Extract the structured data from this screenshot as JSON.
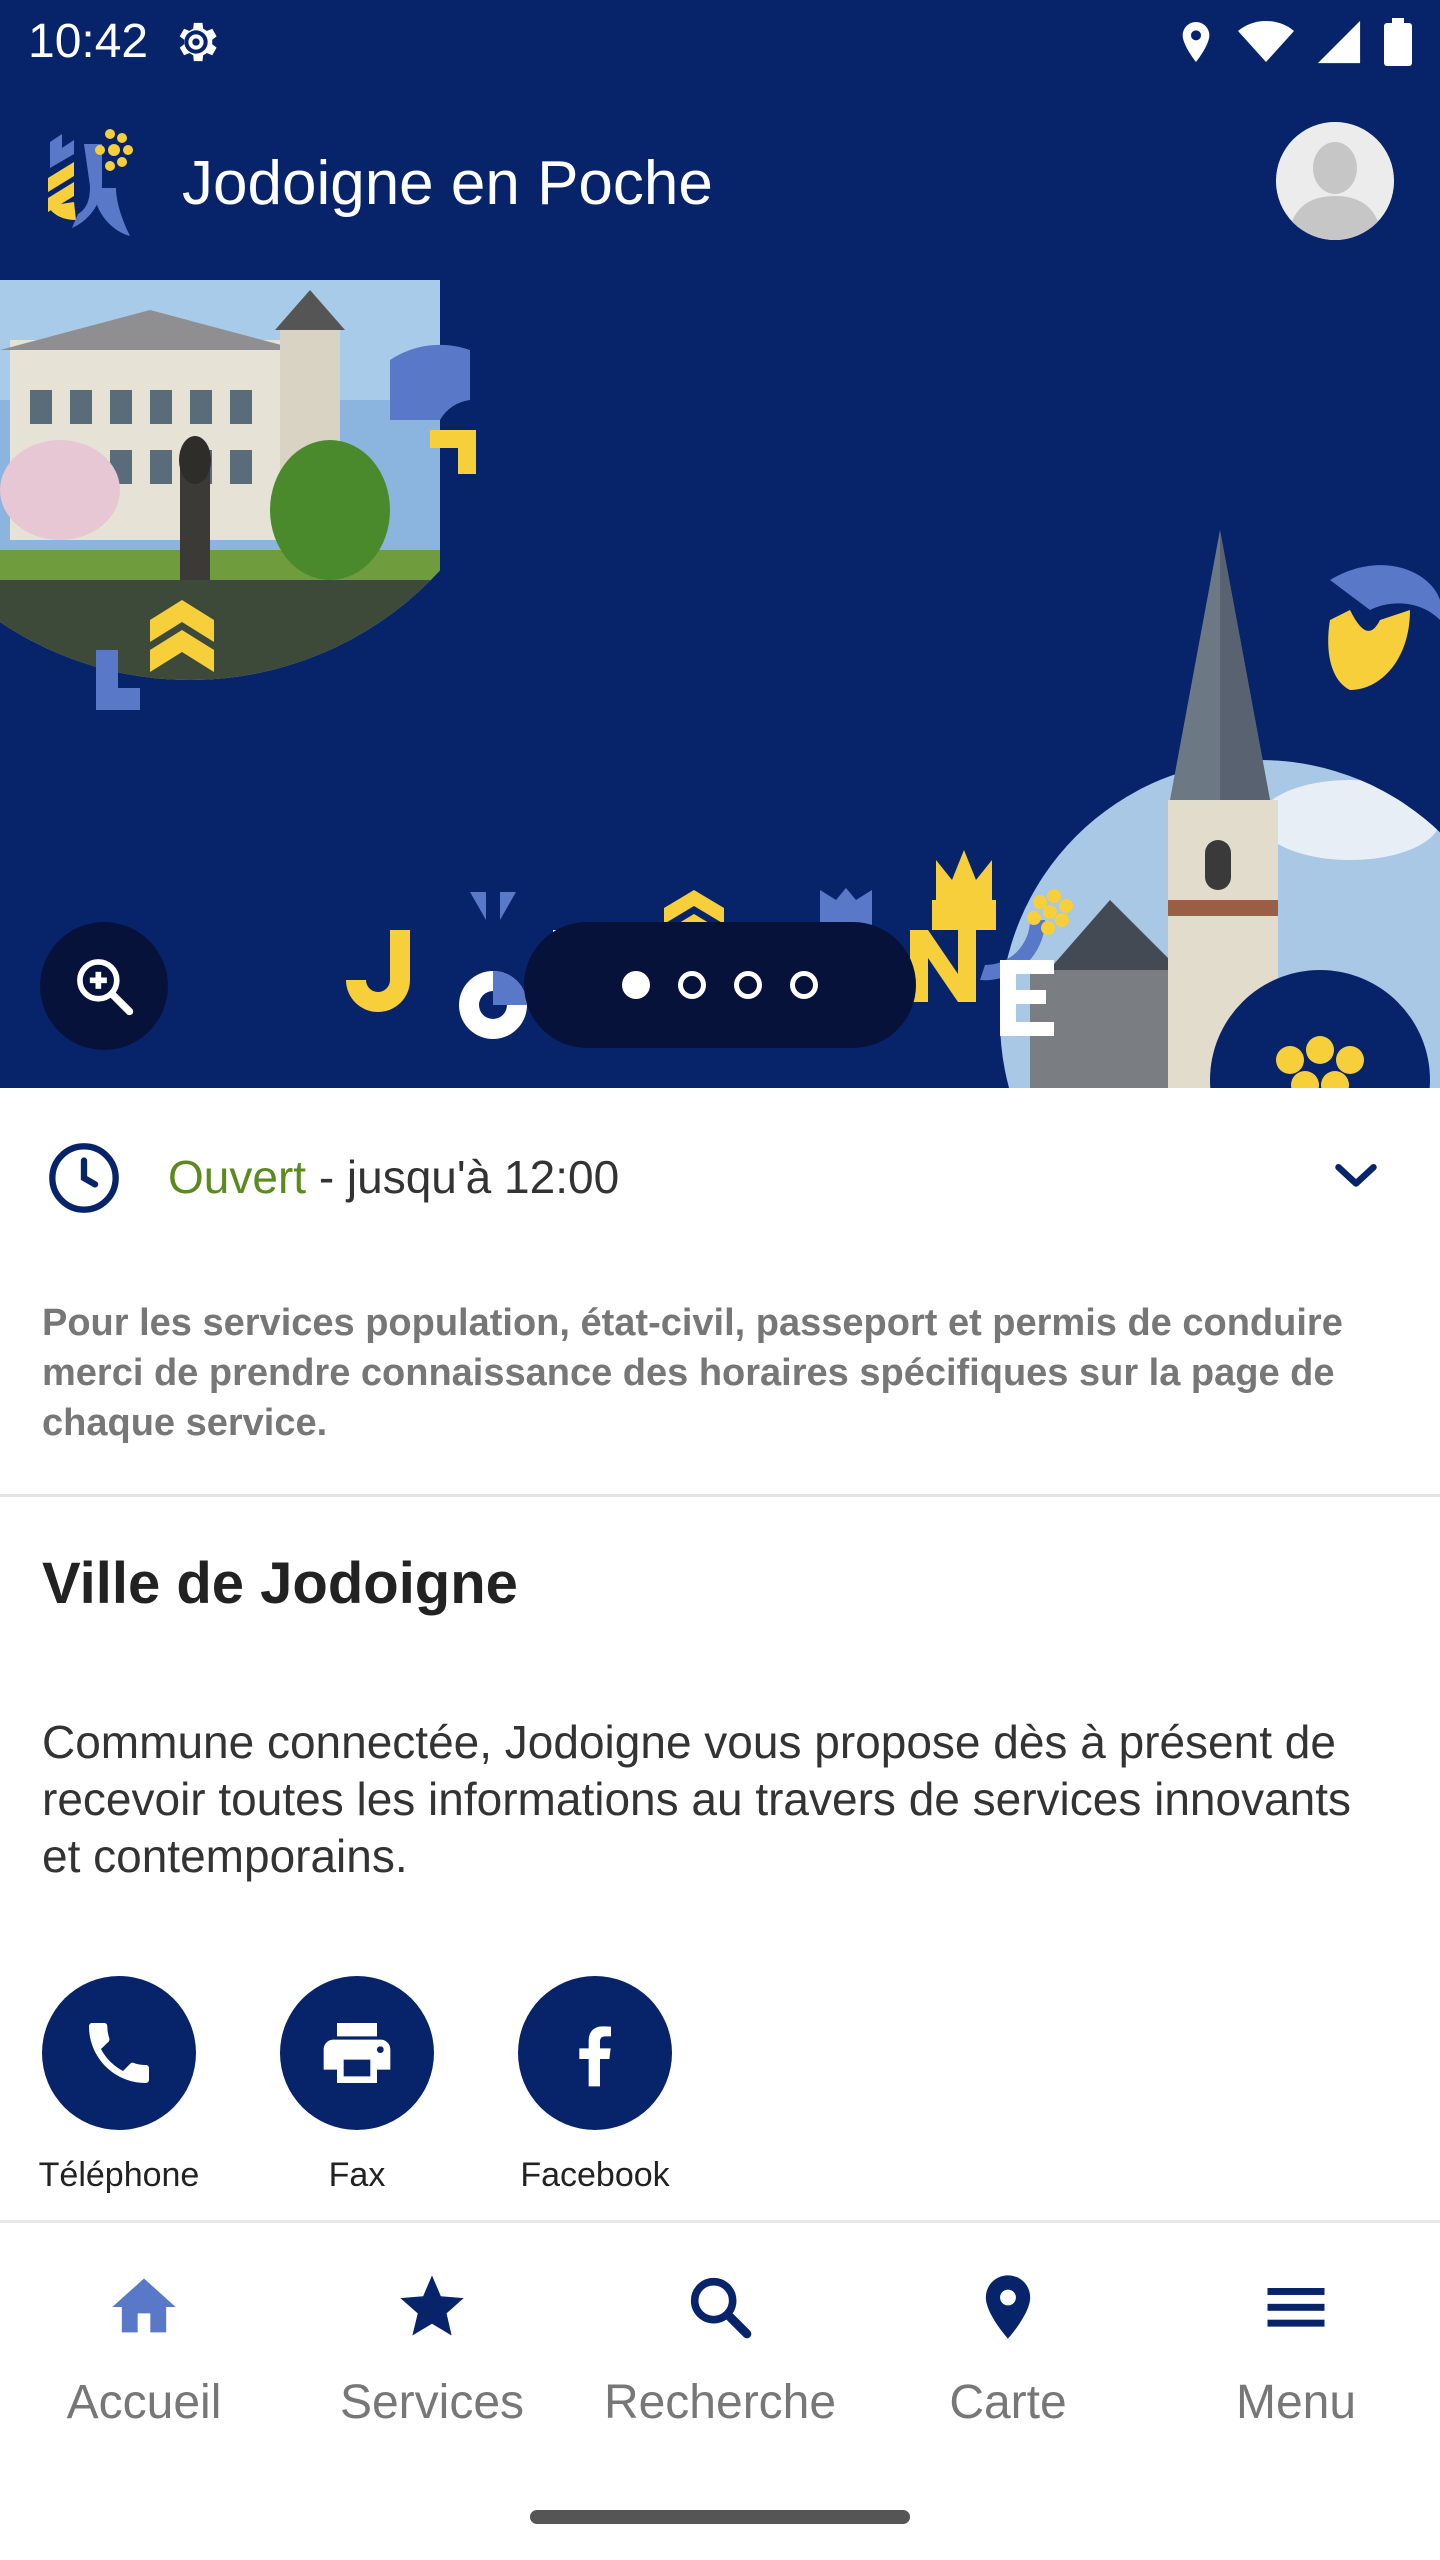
{
  "status_bar": {
    "time": "10:42"
  },
  "app_bar": {
    "title": "Jodoigne en Poche"
  },
  "hero": {
    "brand_text": "JODOIGNE",
    "slides_total": 4,
    "active_slide": 1
  },
  "hours": {
    "status": "Ouvert",
    "detail": " - jusqu'à 12:00"
  },
  "notice": "Pour les services population, état-civil, passeport et permis de conduire merci de prendre connaissance des horaires spécifiques sur la page de chaque service.",
  "section": {
    "title": "Ville de Jodoigne",
    "description": "Commune connectée, Jodoigne vous propose dès à présent de recevoir toutes les informations au travers de services innovants et contemporains."
  },
  "contacts": [
    {
      "label": "Téléphone",
      "icon": "phone-icon"
    },
    {
      "label": "Fax",
      "icon": "printer-icon"
    },
    {
      "label": "Facebook",
      "icon": "facebook-icon"
    }
  ],
  "bottom_nav": [
    {
      "label": "Accueil",
      "icon": "home-icon"
    },
    {
      "label": "Services",
      "icon": "star-icon"
    },
    {
      "label": "Recherche",
      "icon": "search-icon"
    },
    {
      "label": "Carte",
      "icon": "location-pin-icon"
    },
    {
      "label": "Menu",
      "icon": "menu-icon"
    }
  ],
  "colors": {
    "primary": "#07246b",
    "accent_yellow": "#f6cf3b",
    "accent_blue": "#5a78c8",
    "open_green": "#5b8a1e"
  }
}
